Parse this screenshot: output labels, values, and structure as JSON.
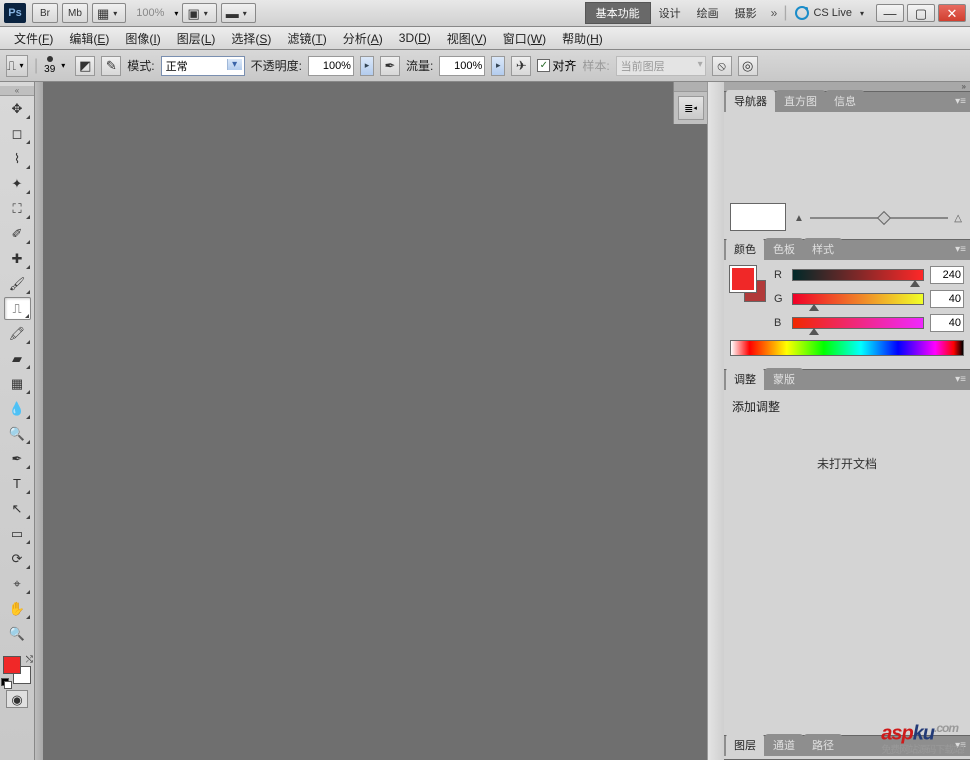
{
  "titlebar": {
    "logo": "Ps",
    "br": "Br",
    "mb": "Mb",
    "zoom": "100%",
    "workspaces": {
      "basic": "基本功能",
      "design": "设计",
      "paint": "绘画",
      "photo": "摄影"
    },
    "cslive": "CS Live"
  },
  "menubar": [
    {
      "label": "文件",
      "key": "F"
    },
    {
      "label": "编辑",
      "key": "E"
    },
    {
      "label": "图像",
      "key": "I"
    },
    {
      "label": "图层",
      "key": "L"
    },
    {
      "label": "选择",
      "key": "S"
    },
    {
      "label": "滤镜",
      "key": "T"
    },
    {
      "label": "分析",
      "key": "A"
    },
    {
      "label": "3D",
      "key": "D"
    },
    {
      "label": "视图",
      "key": "V"
    },
    {
      "label": "窗口",
      "key": "W"
    },
    {
      "label": "帮助",
      "key": "H"
    }
  ],
  "options": {
    "brush_size": "39",
    "mode_label": "模式:",
    "mode_value": "正常",
    "opacity_label": "不透明度:",
    "opacity_value": "100%",
    "flow_label": "流量:",
    "flow_value": "100%",
    "align_label": "对齐",
    "sample_label": "样本:",
    "sample_value": "当前图层"
  },
  "panels": {
    "navigator": {
      "tabs": [
        "导航器",
        "直方图",
        "信息"
      ]
    },
    "color": {
      "tabs": [
        "颜色",
        "色板",
        "样式"
      ],
      "r_label": "R",
      "r_value": "240",
      "g_label": "G",
      "g_value": "40",
      "b_label": "B",
      "b_value": "40",
      "fg_color": "#f02828",
      "bg_color": "#b23a3a"
    },
    "adjustments": {
      "tabs": [
        "调整",
        "蒙版"
      ],
      "title": "添加调整",
      "message": "未打开文档"
    },
    "layers": {
      "tabs": [
        "图层",
        "通道",
        "路径"
      ]
    }
  },
  "watermark": {
    "a": "asp",
    "b": "ku",
    "c": ".com",
    "tag": "免费网站源码下载站!"
  }
}
